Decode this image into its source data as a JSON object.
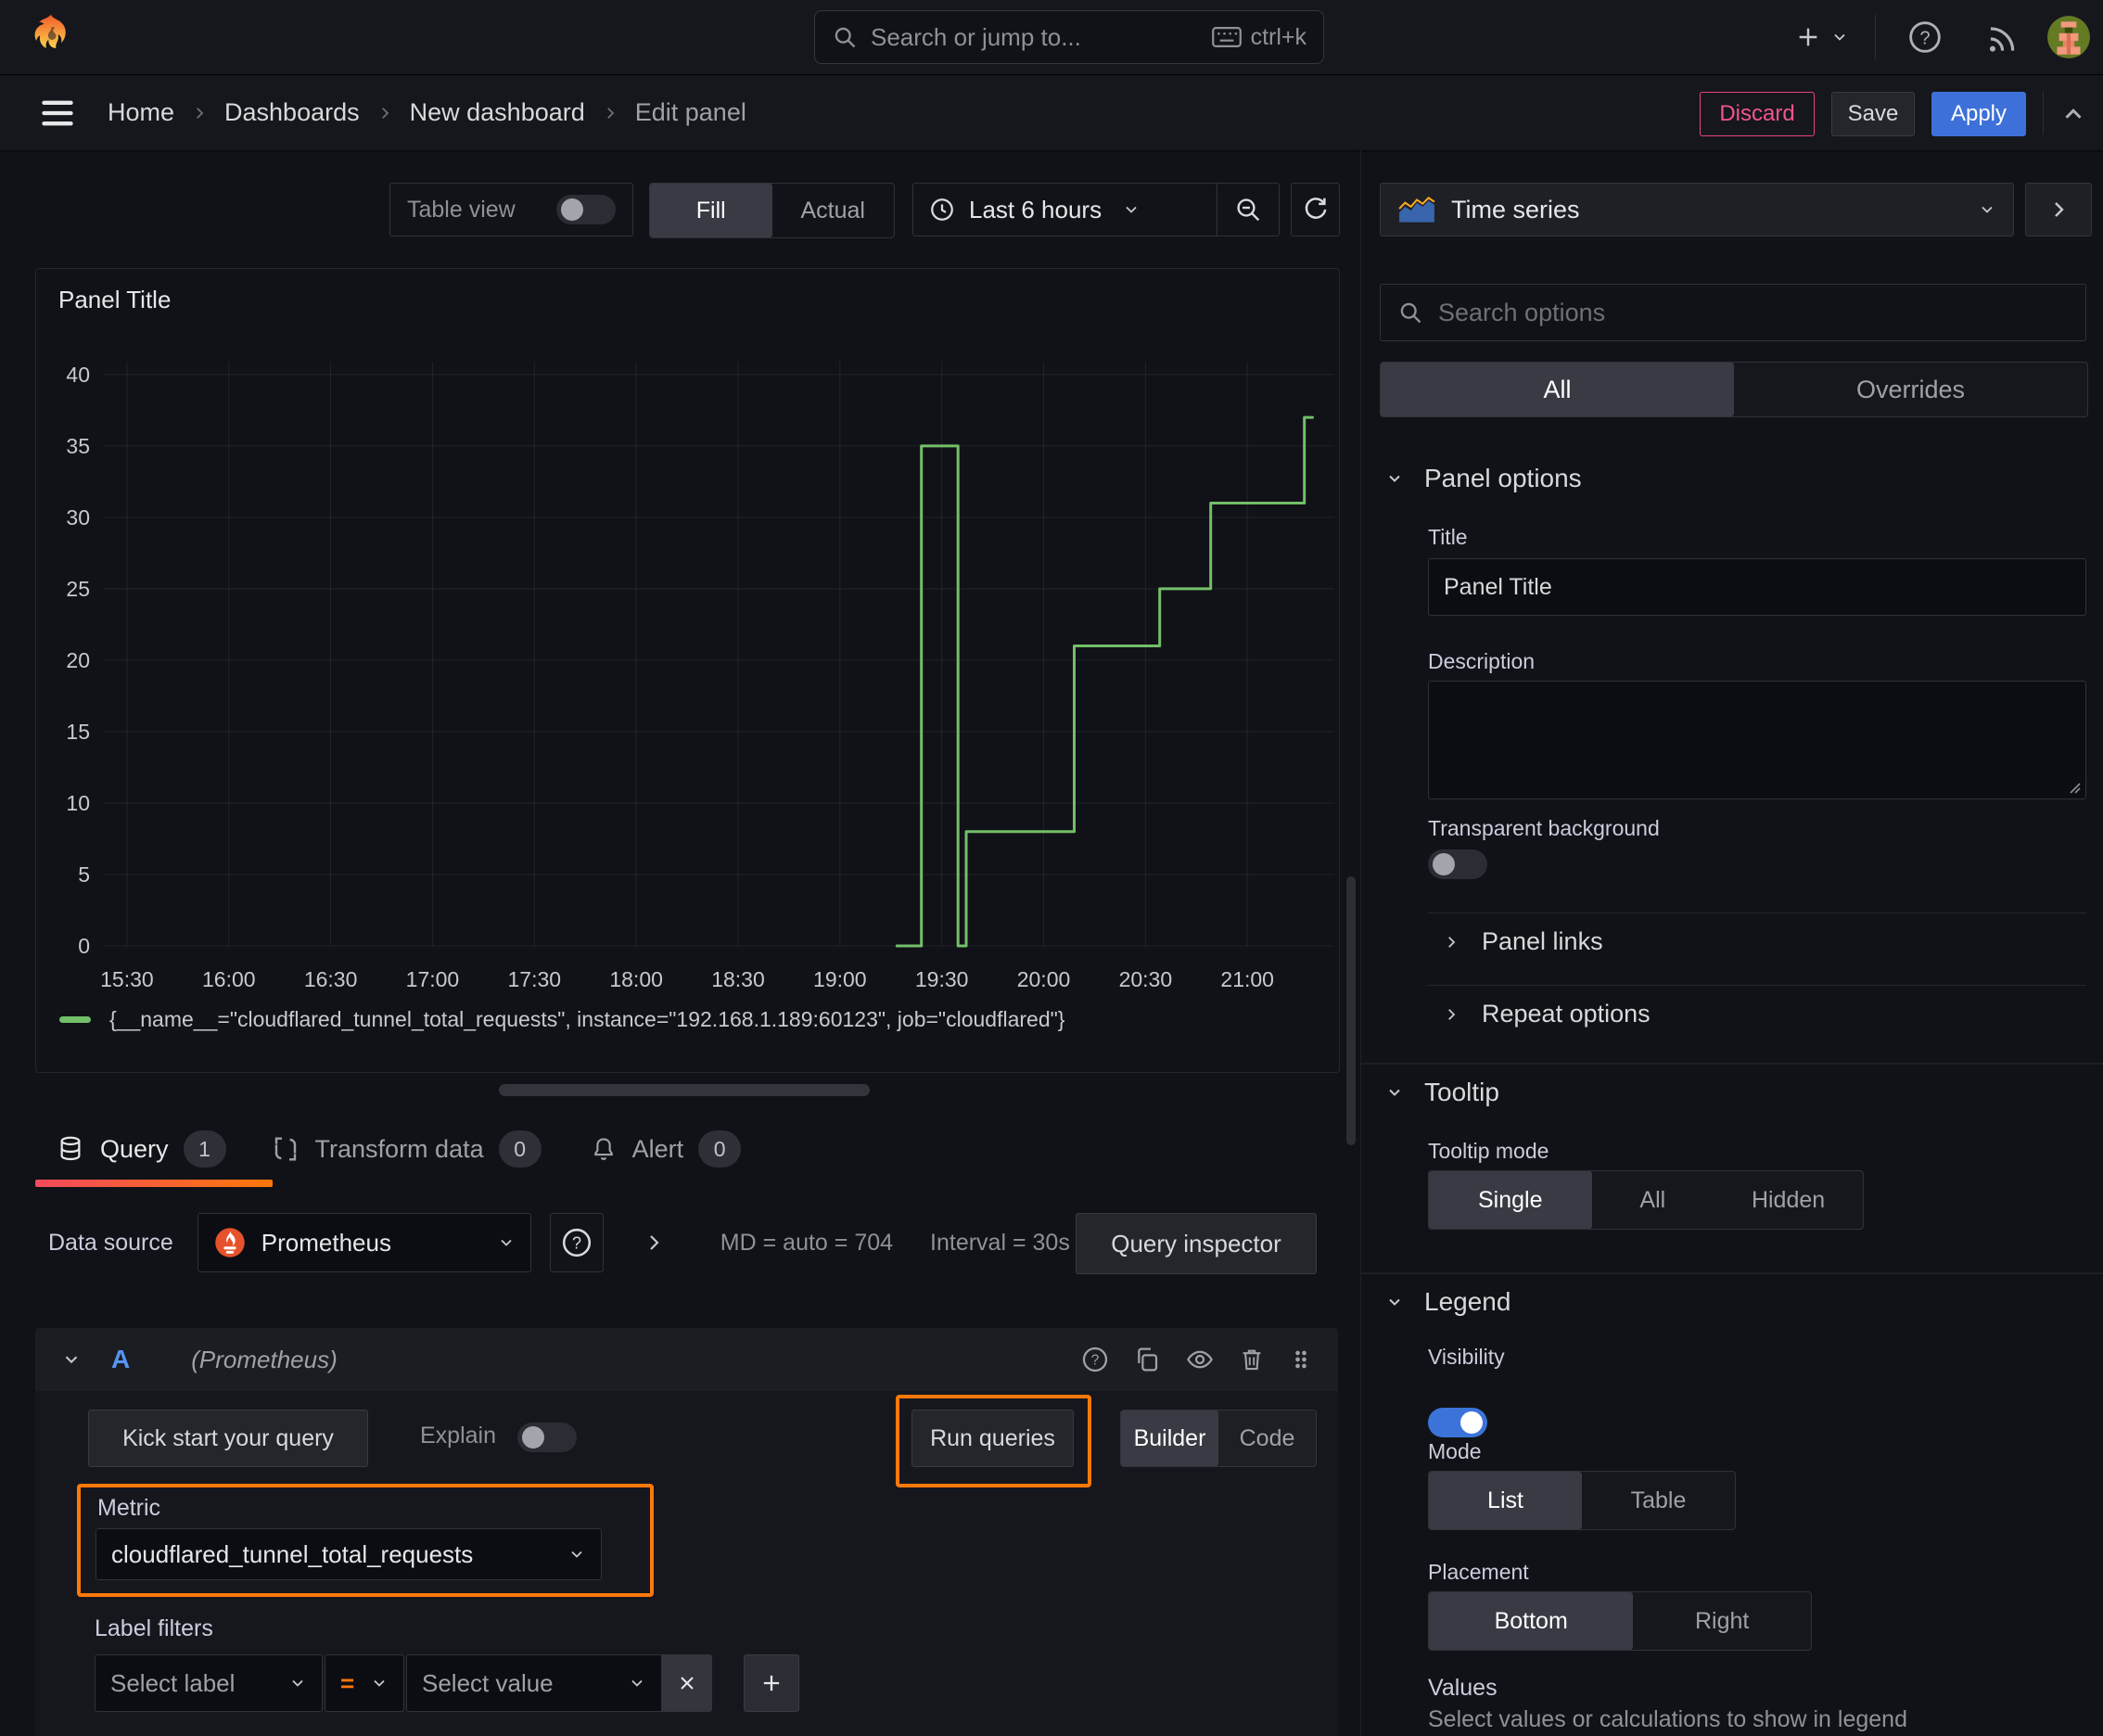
{
  "topbar": {
    "search_placeholder": "Search or jump to...",
    "search_shortcut": "ctrl+k"
  },
  "breadcrumb": {
    "items": [
      "Home",
      "Dashboards",
      "New dashboard",
      "Edit panel"
    ],
    "discard": "Discard",
    "save": "Save",
    "apply": "Apply"
  },
  "toolbar": {
    "table_view": "Table view",
    "fill": "Fill",
    "actual": "Actual",
    "time_range": "Last 6 hours"
  },
  "panel": {
    "title": "Panel Title"
  },
  "chart_data": {
    "type": "line",
    "title": "Panel Title",
    "x_tick_hours": [
      15.5,
      16,
      16.5,
      17,
      17.5,
      18,
      18.5,
      19,
      19.5,
      20,
      20.5,
      21
    ],
    "x_tick_labels": [
      "15:30",
      "16:00",
      "16:30",
      "17:00",
      "17:30",
      "18:00",
      "18:30",
      "19:00",
      "19:30",
      "20:00",
      "20:30",
      "21:00"
    ],
    "y_ticks": [
      0,
      5,
      10,
      15,
      20,
      25,
      30,
      35,
      40
    ],
    "x_domain": [
      15.382,
      21.427
    ],
    "y_domain": [
      0,
      40.9
    ],
    "grid": true,
    "legend_position": "bottom",
    "series": [
      {
        "name": "{__name__=\"cloudflared_tunnel_total_requests\", instance=\"192.168.1.189:60123\", job=\"cloudflared\"}",
        "color": "#73bf69",
        "step_points": [
          [
            19.28,
            0
          ],
          [
            19.4,
            0
          ],
          [
            19.4,
            35
          ],
          [
            19.58,
            35
          ],
          [
            19.58,
            0
          ],
          [
            19.62,
            0
          ],
          [
            19.62,
            8
          ],
          [
            20.15,
            8
          ],
          [
            20.15,
            21
          ],
          [
            20.57,
            21
          ],
          [
            20.57,
            25
          ],
          [
            20.82,
            25
          ],
          [
            20.82,
            31
          ],
          [
            21.28,
            31
          ],
          [
            21.28,
            37
          ],
          [
            21.32,
            37
          ]
        ]
      }
    ]
  },
  "tabs": {
    "query": "Query",
    "query_count": "1",
    "transform": "Transform data",
    "transform_count": "0",
    "alert": "Alert",
    "alert_count": "0"
  },
  "query_editor": {
    "datasource_label": "Data source",
    "datasource": "Prometheus",
    "stats_md": "MD = auto = 704",
    "stats_interval": "Interval = 30s",
    "query_inspector": "Query inspector",
    "ref_id": "A",
    "ref_type": "(Prometheus)",
    "kick_start": "Kick start your query",
    "explain": "Explain",
    "run_queries": "Run queries",
    "builder": "Builder",
    "code": "Code",
    "metric_label": "Metric",
    "metric_value": "cloudflared_tunnel_total_requests",
    "label_filters": "Label filters",
    "select_label": "Select label",
    "operator": "=",
    "select_value": "Select value"
  },
  "sidebar": {
    "visualization": "Time series",
    "search_placeholder": "Search options",
    "tab_all": "All",
    "tab_overrides": "Overrides",
    "panel_options": {
      "heading": "Panel options",
      "title_label": "Title",
      "title_value": "Panel Title",
      "description_label": "Description",
      "transparent_label": "Transparent background"
    },
    "collapsed": {
      "panel_links": "Panel links",
      "repeat_options": "Repeat options"
    },
    "tooltip": {
      "heading": "Tooltip",
      "mode_label": "Tooltip mode",
      "options": [
        "Single",
        "All",
        "Hidden"
      ]
    },
    "legend": {
      "heading": "Legend",
      "visibility_label": "Visibility",
      "mode_label": "Mode",
      "mode_options": [
        "List",
        "Table"
      ],
      "placement_label": "Placement",
      "placement_options": [
        "Bottom",
        "Right"
      ],
      "values_label": "Values",
      "values_help": "Select values or calculations to show in legend"
    }
  },
  "colors": {
    "accent_orange": "#ff780a",
    "apply_blue": "#3d71d9",
    "discard_pink": "#f0558e",
    "series_green": "#73bf69",
    "ref_id_blue": "#5794f2",
    "toggle_on_blue": "#3b73d9",
    "prometheus_orange": "#e6522c",
    "tab_underline_from": "#f2495c",
    "tab_underline_to": "#ff780a"
  }
}
